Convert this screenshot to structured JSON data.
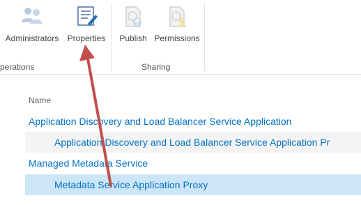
{
  "ribbon": {
    "operations_group": {
      "label": "perations",
      "buttons": [
        {
          "label": "Administrators",
          "icon": "users-icon",
          "enabled": false
        },
        {
          "label": "Properties",
          "icon": "properties-icon",
          "enabled": true
        }
      ]
    },
    "sharing_group": {
      "label": "Sharing",
      "buttons": [
        {
          "label": "Publish",
          "icon": "publish-icon",
          "enabled": false
        },
        {
          "label": "Permissions",
          "icon": "permissions-icon",
          "enabled": false
        }
      ]
    }
  },
  "list": {
    "column_header": "Name",
    "rows": [
      {
        "name": "Application Discovery and Load Balancer Service Application",
        "indent": false,
        "selected": false
      },
      {
        "name": "Application Discovery and Load Balancer Service Application Pr",
        "indent": true,
        "selected": false
      },
      {
        "name": "Managed Metadata Service",
        "indent": false,
        "selected": false
      },
      {
        "name": "Metadata Service Application Proxy",
        "indent": true,
        "selected": true
      }
    ]
  },
  "colors": {
    "link": "#0072c6",
    "selected_row": "#cde6f7",
    "annotation_arrow": "#c0504d"
  }
}
